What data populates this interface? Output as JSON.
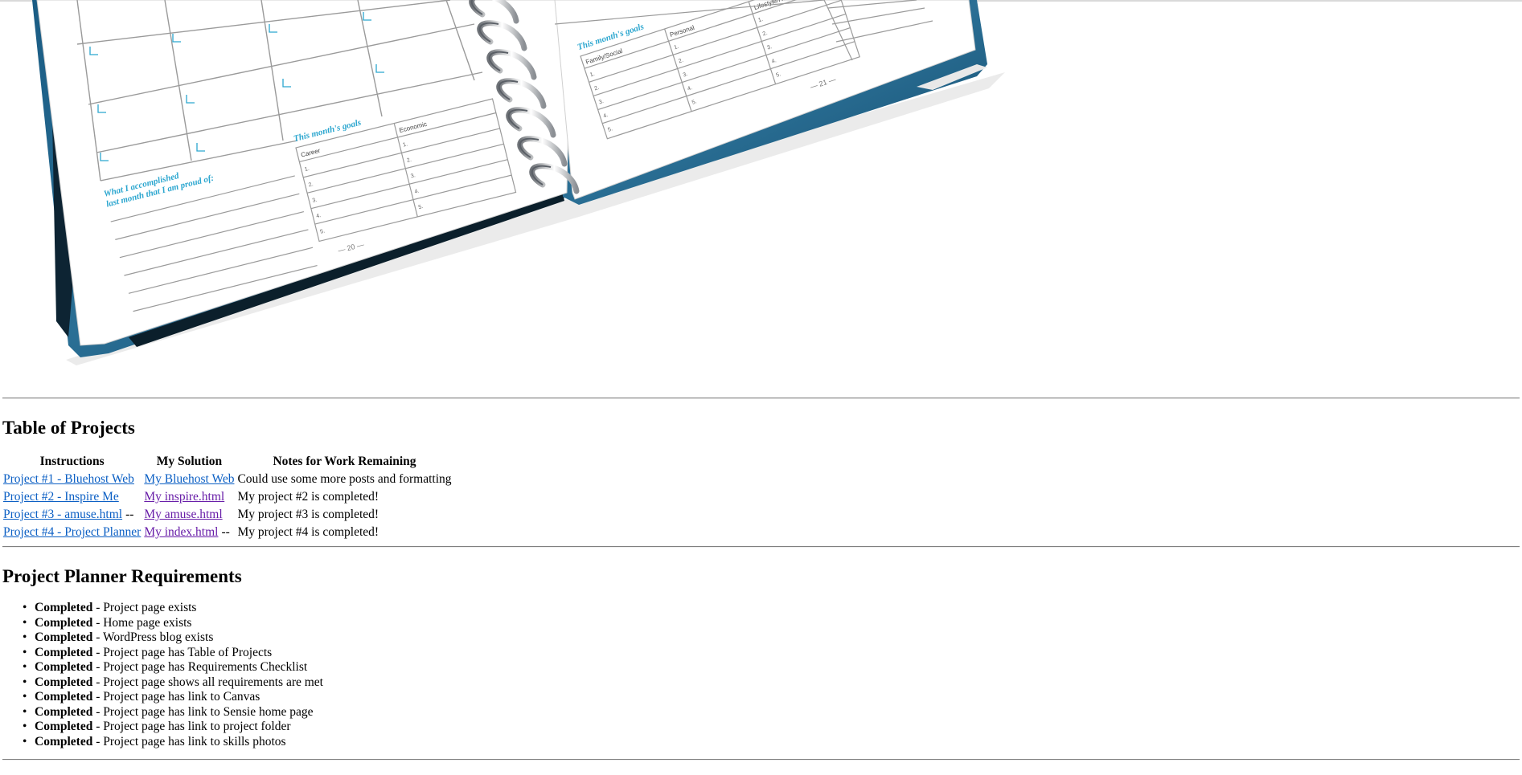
{
  "hero_image": {
    "pages": {
      "left_goals_heading": "This month's goals",
      "left_goals_columns": [
        "Career",
        "Economic"
      ],
      "left_accomplished_heading_line1": "What I accomplished",
      "left_accomplished_heading_line2": "last month that I am proud of:",
      "left_page_number": "— 20 —",
      "right_goals_heading": "This month's goals",
      "right_goals_columns": [
        "Family/Social",
        "Personal",
        "Lifestyle/Health"
      ],
      "right_page_number": "— 21 —",
      "row_numbers": [
        "1.",
        "2.",
        "3.",
        "4.",
        "5."
      ]
    },
    "colors": {
      "cover": "#1d5f86",
      "accent_text": "#2ba6cf",
      "grid_line": "#9a9a9a",
      "paper": "#ffffff"
    }
  },
  "projects_section": {
    "heading": "Table of Projects",
    "columns": [
      "Instructions",
      "My Solution",
      "Notes for Work Remaining"
    ],
    "rows": [
      {
        "instruction": "Project #1 - Bluehost Web",
        "instruction_suffix": "",
        "solution": "My Bluehost Web",
        "solution_suffix": "",
        "notes": "Could use some more posts and formatting"
      },
      {
        "instruction": "Project #2 - Inspire Me",
        "instruction_suffix": "",
        "solution": "My inspire.html",
        "solution_suffix": "",
        "notes": "My project #2 is completed!"
      },
      {
        "instruction": "Project #3 - amuse.html",
        "instruction_suffix": "--",
        "solution": "My amuse.html",
        "solution_suffix": "",
        "notes": "My project #3 is completed!"
      },
      {
        "instruction": "Project #4 - Project Planner",
        "instruction_suffix": "",
        "solution": "My index.html",
        "solution_suffix": "--",
        "notes": "My project #4 is completed!"
      }
    ]
  },
  "requirements_section": {
    "heading": "Project Planner Requirements",
    "items": [
      {
        "status": "Completed",
        "text": " - Project page exists"
      },
      {
        "status": "Completed",
        "text": " - Home page exists"
      },
      {
        "status": "Completed",
        "text": " - WordPress blog exists"
      },
      {
        "status": "Completed",
        "text": " - Project page has Table of Projects"
      },
      {
        "status": "Completed",
        "text": " - Project page has Requirements Checklist"
      },
      {
        "status": "Completed",
        "text": " - Project page shows all requirements are met"
      },
      {
        "status": "Completed",
        "text": " - Project page has link to Canvas"
      },
      {
        "status": "Completed",
        "text": " - Project page has link to Sensie home page"
      },
      {
        "status": "Completed",
        "text": " - Project page has link to project folder"
      },
      {
        "status": "Completed",
        "text": " - Project page has link to skills photos"
      }
    ]
  }
}
